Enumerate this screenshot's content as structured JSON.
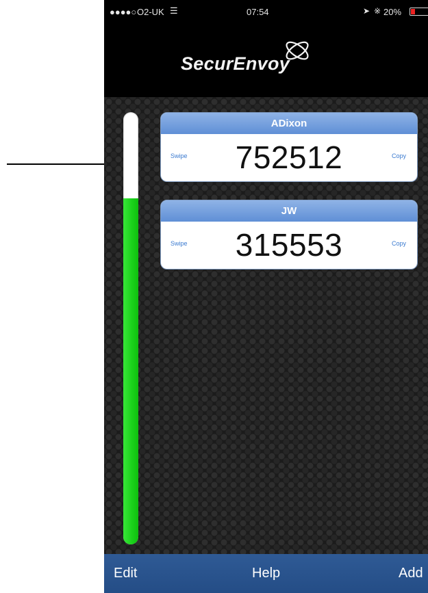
{
  "status_bar": {
    "signal": "●●●●○",
    "carrier": "O2-UK",
    "time": "07:54",
    "battery_percent": "20%"
  },
  "app": {
    "brand": "SecurEnvoy"
  },
  "timer": {
    "remaining_fraction": 0.8
  },
  "tokens": [
    {
      "name": "ADixon",
      "passcode": "752512",
      "swipe_label": "Swipe",
      "copy_label": "Copy"
    },
    {
      "name": "JW",
      "passcode": "315553",
      "swipe_label": "Swipe",
      "copy_label": "Copy"
    }
  ],
  "tab_bar": {
    "edit": "Edit",
    "help": "Help",
    "add": "Add"
  },
  "colors": {
    "accent": "#2f5a95",
    "timer_green": "#1cd21c",
    "card_header": "#6f9bdc"
  }
}
